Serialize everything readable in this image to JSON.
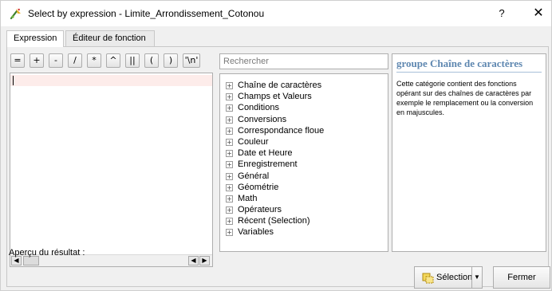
{
  "window": {
    "title": "Select by expression - Limite_Arrondissement_Cotonou",
    "help_label": "?",
    "close_label": "✕"
  },
  "tabs": [
    {
      "label": "Expression",
      "active": true
    },
    {
      "label": "Éditeur de fonction",
      "active": false
    }
  ],
  "operators": [
    "=",
    "+",
    "-",
    "/",
    "*",
    "^",
    "||",
    "(",
    ")",
    "'\\n'"
  ],
  "expression_editor": {
    "value": "",
    "scroll_left_arrow": "◀",
    "scroll_right_arrow": "▶"
  },
  "preview": {
    "label": "Aperçu du résultat :"
  },
  "search": {
    "placeholder": "Rechercher",
    "value": ""
  },
  "function_groups": [
    "Chaîne de caractères",
    "Champs et Valeurs",
    "Conditions",
    "Conversions",
    "Correspondance floue",
    "Couleur",
    "Date et Heure",
    "Enregistrement",
    "Général",
    "Géométrie",
    "Math",
    "Opérateurs",
    "Récent (Selection)",
    "Variables"
  ],
  "expander_symbol": "+",
  "help": {
    "title": "groupe Chaîne de caractères",
    "body": "Cette catégorie contient des fonctions opérant sur des chaînes de caractères par exemple le remplacement ou la conversion en majuscules."
  },
  "buttons": {
    "selection_label": "Sélection",
    "dropdown_arrow": "▼",
    "close_label": "Fermer"
  },
  "colors": {
    "help_title": "#5e87b0",
    "expression_line_highlight": "#fdecea"
  }
}
